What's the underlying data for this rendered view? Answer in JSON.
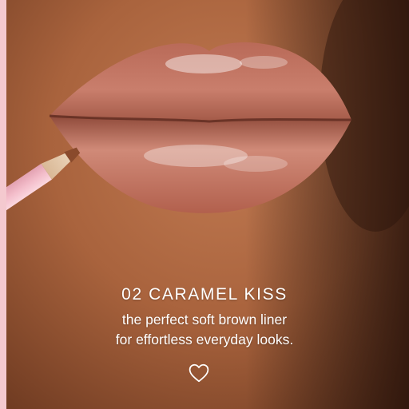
{
  "caption": {
    "shade_name": "02 CARAMEL KISS",
    "tagline_line1": "the perfect soft brown liner",
    "tagline_line2": "for effortless everyday looks."
  },
  "icons": {
    "like": "heart-outline-icon"
  },
  "colors": {
    "text": "#ffffff",
    "border_accent": "#f4c9cf",
    "pencil_barrel": "#f6c3cf",
    "pencil_lead": "#8a4a2c",
    "skin": "#b06a44",
    "lip": "#c9786a"
  }
}
